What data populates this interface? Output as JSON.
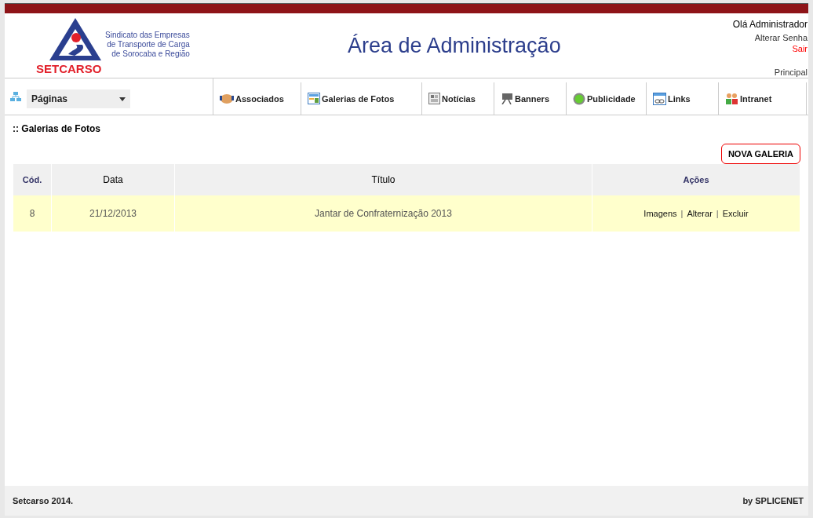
{
  "header": {
    "logo_text": "SETCARSO",
    "tagline": [
      "Sindicato das Empresas",
      "de Transporte de Carga",
      "de Sorocaba e Região"
    ],
    "title": "Área de Administração",
    "greeting": "Olá Administrador",
    "change_password": "Alterar Senha",
    "logout": "Sair",
    "home": "Principal"
  },
  "nav": {
    "pages_select": "Páginas",
    "items": [
      {
        "label": "Associados"
      },
      {
        "label": "Galerias de Fotos"
      },
      {
        "label": "Notícias"
      },
      {
        "label": "Banners"
      },
      {
        "label": "Publicidade"
      },
      {
        "label": "Links"
      },
      {
        "label": "Intranet"
      }
    ]
  },
  "section_title": ":: Galerias de Fotos",
  "new_button": "NOVA GALERIA",
  "table": {
    "columns": [
      "Cód.",
      "Data",
      "Título",
      "Ações"
    ],
    "rows": [
      {
        "code": "8",
        "date": "21/12/2013",
        "title": "Jantar de Confraternização 2013",
        "actions": [
          {
            "kind": "link",
            "label": "Imagens"
          },
          {
            "kind": "separator",
            "label": "|"
          },
          {
            "kind": "link",
            "label": "Alterar"
          },
          {
            "kind": "separator",
            "label": "|"
          },
          {
            "kind": "link",
            "label": "Excluir"
          }
        ]
      }
    ]
  },
  "footer": {
    "left": "Setcarso 2014.",
    "right": "by SPLICENET"
  }
}
